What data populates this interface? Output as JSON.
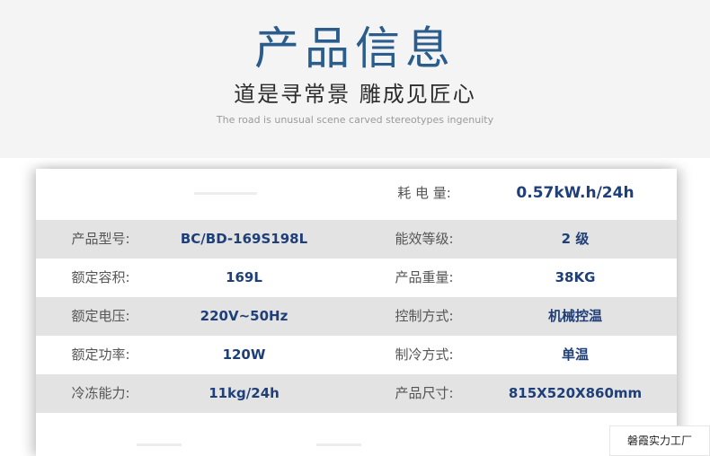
{
  "header": {
    "title": "产品信息",
    "subtitle": "道是寻常景 雕成见匠心",
    "subtitle_en": "The road is unusual scene carved stereotypes ingenuity"
  },
  "specs": {
    "rows": [
      {
        "label1": "",
        "value1": "",
        "label2": "耗 电 量:",
        "value2": "0.57kW.h/24h"
      },
      {
        "label1": "产品型号:",
        "value1": "BC/BD-169S198L",
        "label2": "能效等级:",
        "value2": "2 级"
      },
      {
        "label1": "额定容积:",
        "value1": "169L",
        "label2": "产品重量:",
        "value2": "38KG"
      },
      {
        "label1": "额定电压:",
        "value1": "220V~50Hz",
        "label2": "控制方式:",
        "value2": "机械控温"
      },
      {
        "label1": "额定功率:",
        "value1": "120W",
        "label2": "制冷方式:",
        "value2": "单温"
      },
      {
        "label1": "冷冻能力:",
        "value1": "11kg/24h",
        "label2": "产品尺寸:",
        "value2": "815X520X860mm"
      }
    ]
  },
  "watermark": "磐霞实力工厂",
  "colors": {
    "title": "#2a5c8c",
    "value_text": "#1f3f78",
    "row_shade": "#e3e3e3"
  }
}
